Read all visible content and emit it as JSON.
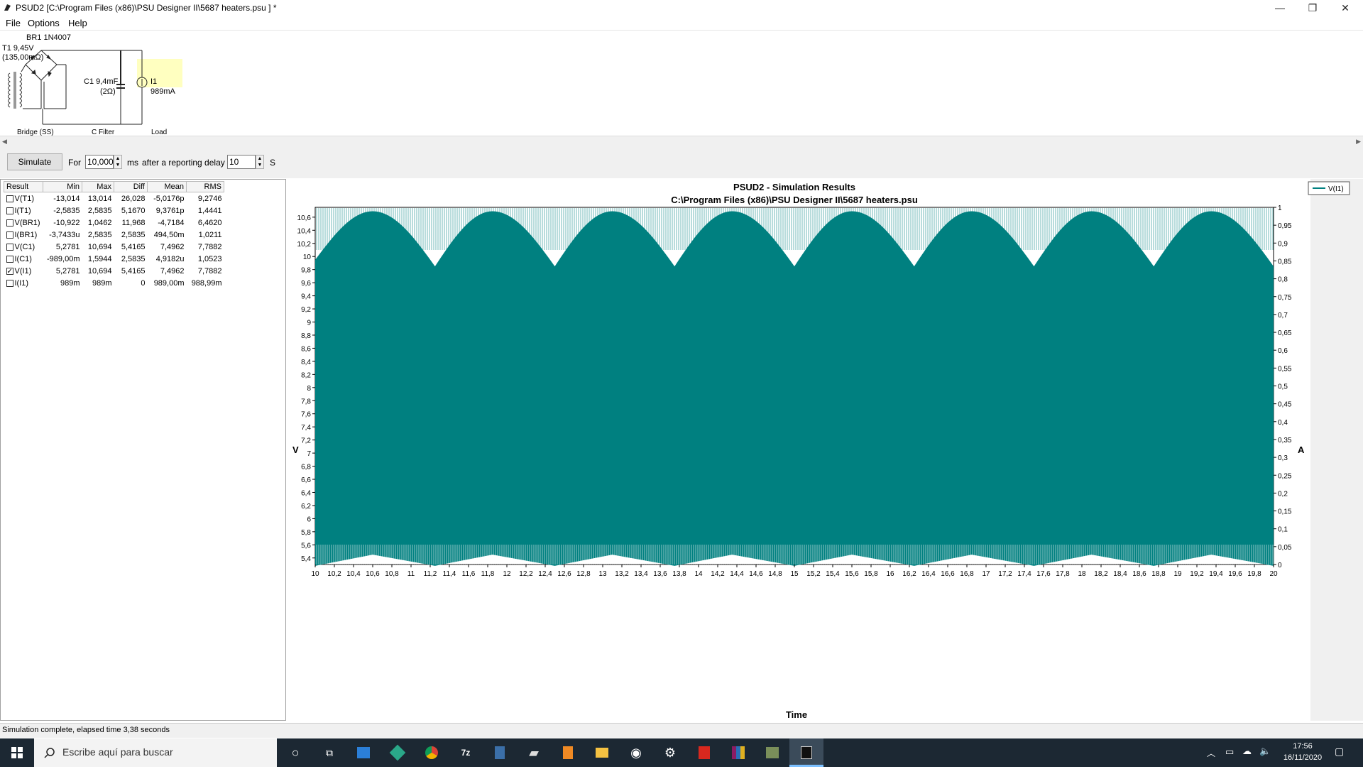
{
  "window": {
    "title": "PSUD2  [C:\\Program Files (x86)\\PSU Designer II\\5687 heaters.psu ] *",
    "minimize_glyph": "—",
    "restore_glyph": "❐",
    "close_glyph": "✕"
  },
  "menu": {
    "items": [
      "File",
      "Options",
      "Help"
    ]
  },
  "schematic": {
    "bridge_name": "BR1 1N4007",
    "transformer_label": "T1 9,45V",
    "transformer_res": "(135,00mΩ)",
    "cap_label": "C1 9,4mF",
    "cap_res": "(2Ω)",
    "load_name": "I1",
    "load_current": "989mA",
    "section_bridge": "Bridge (SS)",
    "section_filter": "C Filter",
    "section_load": "Load"
  },
  "toolbar": {
    "simulate_label": "Simulate",
    "for_label": "For",
    "duration_value": "10,000",
    "ms_label": "ms",
    "delay_label": "after a reporting delay of",
    "delay_value": "10",
    "s_label": "S"
  },
  "results": {
    "headers": [
      "Result",
      "Min",
      "Max",
      "Diff",
      "Mean",
      "RMS"
    ],
    "rows": [
      {
        "name": "V(T1)",
        "min": "-13,014",
        "max": "13,014",
        "diff": "26,028",
        "mean": "-5,0176p",
        "rms": "9,2746",
        "checked": false
      },
      {
        "name": "I(T1)",
        "min": "-2,5835",
        "max": "2,5835",
        "diff": "5,1670",
        "mean": "9,3761p",
        "rms": "1,4441",
        "checked": false
      },
      {
        "name": "V(BR1)",
        "min": "-10,922",
        "max": "1,0462",
        "diff": "11,968",
        "mean": "-4,7184",
        "rms": "6,4620",
        "checked": false
      },
      {
        "name": "I(BR1)",
        "min": "-3,7433u",
        "max": "2,5835",
        "diff": "2,5835",
        "mean": "494,50m",
        "rms": "1,0211",
        "checked": false
      },
      {
        "name": "V(C1)",
        "min": "5,2781",
        "max": "10,694",
        "diff": "5,4165",
        "mean": "7,4962",
        "rms": "7,7882",
        "checked": false
      },
      {
        "name": "I(C1)",
        "min": "-989,00m",
        "max": "1,5944",
        "diff": "2,5835",
        "mean": "4,9182u",
        "rms": "1,0523",
        "checked": false
      },
      {
        "name": "V(I1)",
        "min": "5,2781",
        "max": "10,694",
        "diff": "5,4165",
        "mean": "7,4962",
        "rms": "7,7882",
        "checked": true
      },
      {
        "name": "I(I1)",
        "min": "989m",
        "max": "989m",
        "diff": "0",
        "mean": "989,00m",
        "rms": "988,99m",
        "checked": false
      }
    ]
  },
  "chart_data": {
    "type": "line",
    "title": "PSUD2 - Simulation Results",
    "subtitle": "C:\\Program Files (x86)\\PSU Designer II\\5687 heaters.psu",
    "xlabel": "Time",
    "ylabel": "V",
    "y2label": "A",
    "xlim": [
      10,
      20
    ],
    "ylim": [
      5.3,
      10.75
    ],
    "y2lim": [
      0,
      1
    ],
    "x_ticks": [
      "10",
      "10,2",
      "10,4",
      "10,6",
      "10,8",
      "11",
      "11,2",
      "11,4",
      "11,6",
      "11,8",
      "12",
      "12,2",
      "12,4",
      "12,6",
      "12,8",
      "13",
      "13,2",
      "13,4",
      "13,6",
      "13,8",
      "14",
      "14,2",
      "14,4",
      "14,6",
      "14,8",
      "15",
      "15,2",
      "15,4",
      "15,6",
      "15,8",
      "16",
      "16,2",
      "16,4",
      "16,6",
      "16,8",
      "17",
      "17,2",
      "17,4",
      "17,6",
      "17,8",
      "18",
      "18,2",
      "18,4",
      "18,6",
      "18,8",
      "19",
      "19,2",
      "19,4",
      "19,6",
      "19,8",
      "20"
    ],
    "y_ticks": [
      "10,6",
      "10,4",
      "10,2",
      "10",
      "9,8",
      "9,6",
      "9,4",
      "9,2",
      "9",
      "8,8",
      "8,6",
      "8,4",
      "8,2",
      "8",
      "7,8",
      "7,6",
      "7,4",
      "7,2",
      "7",
      "6,8",
      "6,6",
      "6,4",
      "6,2",
      "6",
      "5,8",
      "5,6",
      "5,4"
    ],
    "y2_ticks": [
      "1",
      "0,95",
      "0,9",
      "0,85",
      "0,8",
      "0,75",
      "0,7",
      "0,65",
      "0,6",
      "0,55",
      "0,5",
      "0,45",
      "0,4",
      "0,35",
      "0,3",
      "0,25",
      "0,2",
      "0,15",
      "0,1",
      "0,05",
      "0"
    ],
    "series": [
      {
        "name": "V(I1)",
        "color": "#008080",
        "x": [
          10,
          10.6,
          11.25,
          11.85,
          12.5,
          13.1,
          13.75,
          14.35,
          15.0,
          15.6,
          16.25,
          16.85,
          17.5,
          18.1,
          18.75,
          19.35,
          20
        ],
        "y_upper": [
          9.95,
          10.69,
          9.85,
          10.69,
          9.85,
          10.69,
          9.85,
          10.69,
          9.85,
          10.69,
          9.85,
          10.69,
          9.85,
          10.69,
          9.85,
          10.69,
          9.85
        ],
        "y_lower": [
          5.28,
          5.45,
          5.28,
          5.45,
          5.28,
          5.45,
          5.28,
          5.45,
          5.28,
          5.45,
          5.28,
          5.45,
          5.28,
          5.45,
          5.28,
          5.45,
          5.28
        ]
      }
    ],
    "legend": [
      "V(I1)"
    ],
    "legend_position": "top-right"
  },
  "status": {
    "text": "Simulation complete, elapsed time 3,38 seconds"
  },
  "taskbar": {
    "search_placeholder": "Escribe aquí para buscar",
    "time": "17:56",
    "date": "16/11/2020"
  },
  "icons": [
    "windows-start-icon",
    "search-icon",
    "cortana-icon",
    "task-view-icon",
    "store-icon",
    "app-icon",
    "chrome-icon",
    "7zip-icon",
    "calculator-icon",
    "printer-icon",
    "notepad-icon",
    "file-explorer-icon",
    "steam-icon",
    "settings-icon",
    "acrobat-icon",
    "winrar-icon",
    "archive-icon",
    "psud2-taskbar-icon"
  ]
}
